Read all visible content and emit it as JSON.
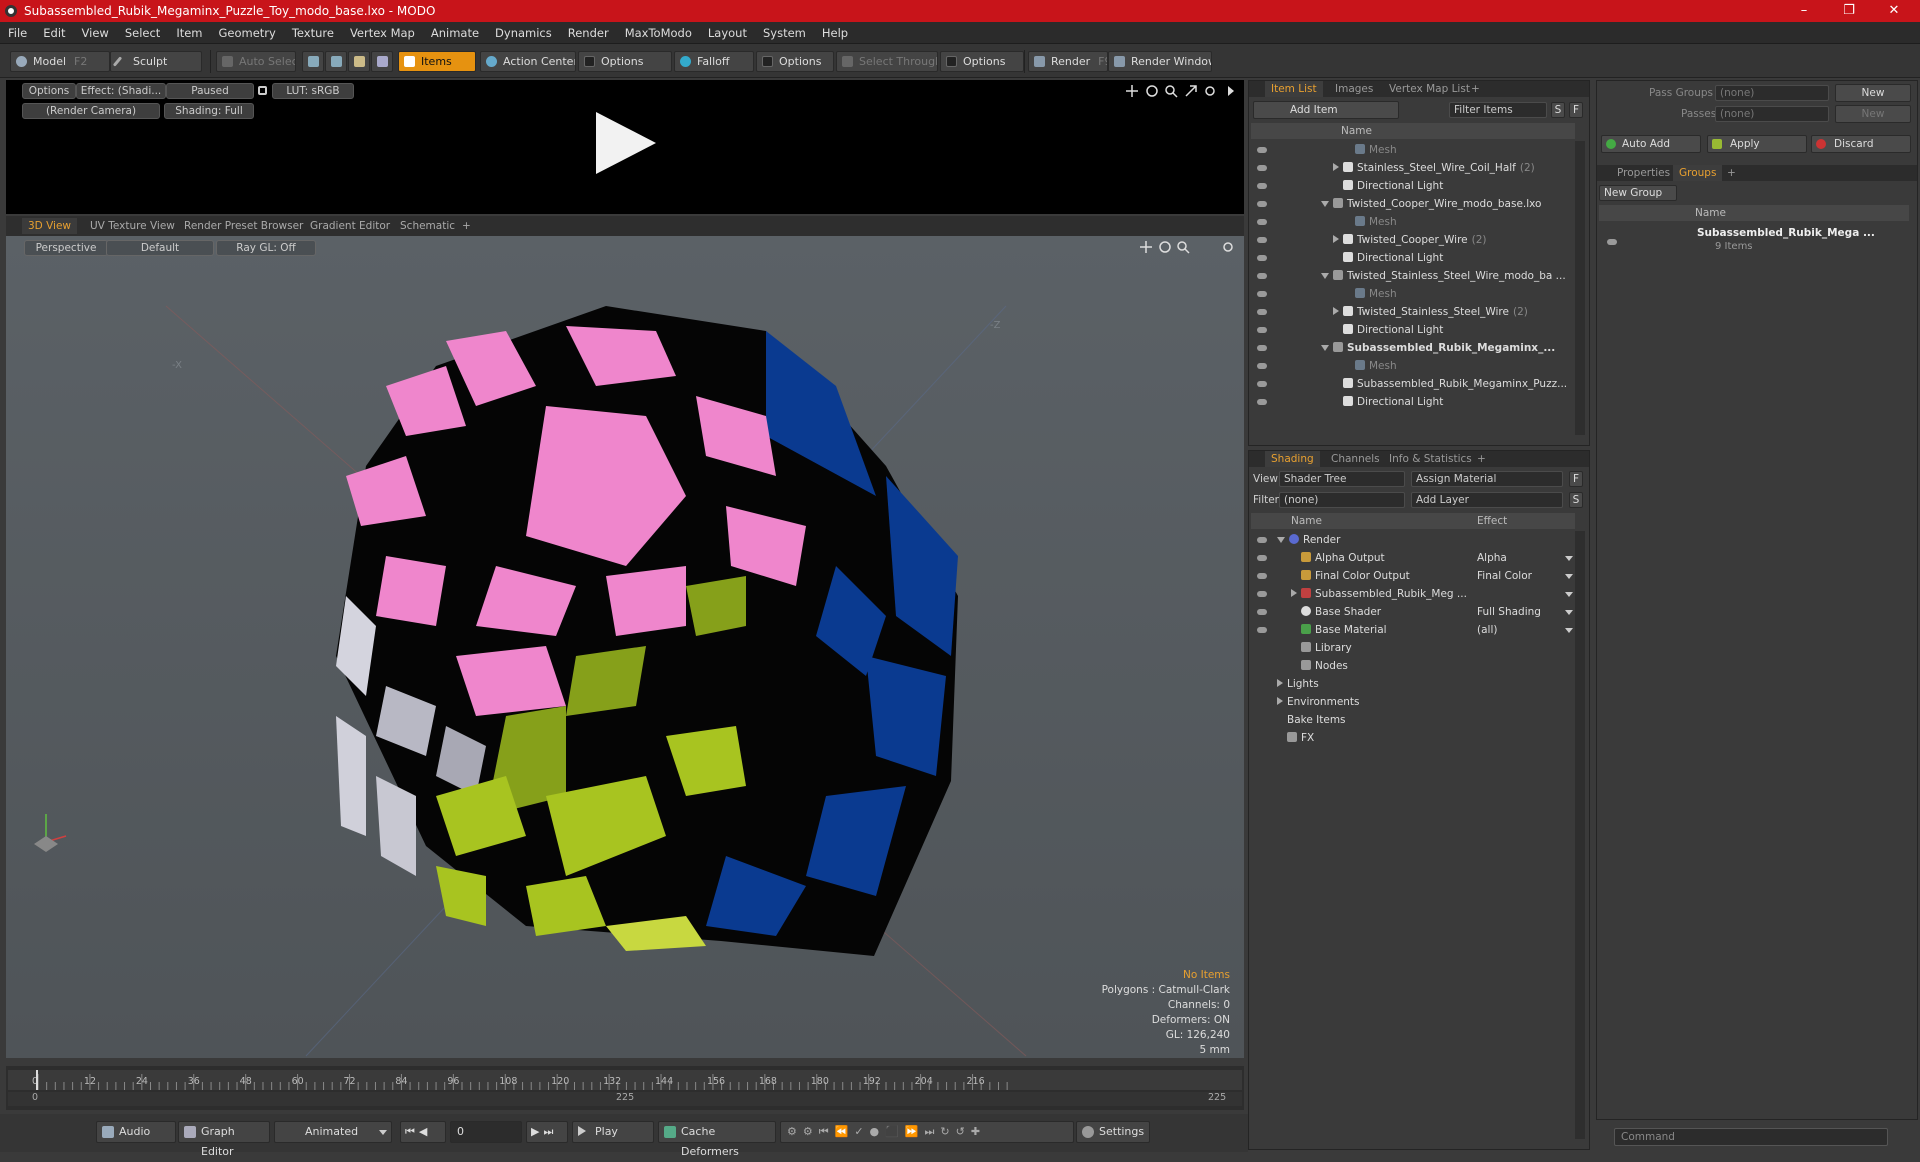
{
  "window": {
    "title": "Subassembled_Rubik_Megaminx_Puzzle_Toy_modo_base.lxo - MODO",
    "controls": [
      "–",
      "❐",
      "✕"
    ]
  },
  "menu": [
    "File",
    "Edit",
    "View",
    "Select",
    "Item",
    "Geometry",
    "Texture",
    "Vertex Map",
    "Animate",
    "Dynamics",
    "Render",
    "MaxToModo",
    "Layout",
    "System",
    "Help"
  ],
  "toolbar": {
    "model": "Model",
    "model_key": "F2",
    "sculpt": "Sculpt",
    "auto_select": "Auto Select",
    "items": "Items",
    "action_center": "Action Center",
    "options1": "Options",
    "falloff": "Falloff",
    "options2": "Options",
    "select_through": "Select Through",
    "options3": "Options",
    "render": "Render",
    "render_key": "F9",
    "render_window": "Render Window"
  },
  "preview": {
    "options": "Options",
    "effect": "Effect: (Shadi...",
    "paused": "Paused",
    "lut": "LUT: sRGB",
    "camera": "(Render Camera)",
    "shading": "Shading: Full"
  },
  "viewtabs": [
    "3D View",
    "UV Texture View",
    "Render Preset Browser",
    "Gradient Editor",
    "Schematic",
    "+"
  ],
  "viewport": {
    "perspective": "Perspective",
    "default": "Default",
    "raygl": "Ray GL: Off",
    "axis_x": "-X",
    "axis_z": "-Z",
    "info": {
      "no_items": "No Items",
      "polygons": "Polygons : Catmull-Clark",
      "channels": "Channels: 0",
      "deformers": "Deformers: ON",
      "gl": "GL: 126,240",
      "scale": "5 mm"
    }
  },
  "timeline": {
    "ticks": [
      "0",
      "12",
      "24",
      "36",
      "48",
      "60",
      "72",
      "84",
      "96",
      "108",
      "120",
      "132",
      "144",
      "156",
      "168",
      "180",
      "192",
      "204",
      "216"
    ],
    "start": "0",
    "mid": "225",
    "end": "225"
  },
  "bottombar": {
    "audio": "Audio",
    "graph_editor": "Graph Editor",
    "animated": "Animated",
    "frame": "0",
    "play": "Play",
    "cache": "Cache Deformers",
    "settings": "Settings"
  },
  "itemlist": {
    "tabs": [
      "Item List",
      "Images",
      "Vertex Map List",
      "+"
    ],
    "add_item": "Add Item",
    "filter_items": "Filter Items",
    "s": "S",
    "f": "F",
    "col_name": "Name",
    "rows": [
      {
        "label": "Mesh",
        "indent": 3,
        "dim": true
      },
      {
        "label": "Stainless_Steel_Wire_Coil_Half",
        "count": "(2)",
        "indent": 2
      },
      {
        "label": "Directional Light",
        "indent": 2
      },
      {
        "label": "Twisted_Cooper_Wire_modo_base.lxo",
        "indent": 1
      },
      {
        "label": "Mesh",
        "indent": 3,
        "dim": true
      },
      {
        "label": "Twisted_Cooper_Wire",
        "count": "(2)",
        "indent": 2
      },
      {
        "label": "Directional Light",
        "indent": 2
      },
      {
        "label": "Twisted_Stainless_Steel_Wire_modo_ba ...",
        "indent": 1
      },
      {
        "label": "Mesh",
        "indent": 3,
        "dim": true
      },
      {
        "label": "Twisted_Stainless_Steel_Wire",
        "count": "(2)",
        "indent": 2
      },
      {
        "label": "Directional Light",
        "indent": 2
      },
      {
        "label": "Subassembled_Rubik_Megaminx_...",
        "indent": 1,
        "bold": true
      },
      {
        "label": "Mesh",
        "indent": 3,
        "dim": true
      },
      {
        "label": "Subassembled_Rubik_Megaminx_Puzz...",
        "indent": 2
      },
      {
        "label": "Directional Light",
        "indent": 2
      }
    ]
  },
  "shading": {
    "tabs": [
      "Shading",
      "Channels",
      "Info & Statistics",
      "+"
    ],
    "view_label": "View",
    "view_value": "Shader Tree",
    "assign": "Assign Material",
    "filter_label": "Filter",
    "filter_value": "(none)",
    "add_layer": "Add Layer",
    "f": "F",
    "s": "S",
    "col_name": "Name",
    "col_effect": "Effect",
    "rows": [
      {
        "label": "Render",
        "effect": "",
        "indent": 0,
        "color": "#5a6ad0"
      },
      {
        "label": "Alpha Output",
        "effect": "Alpha",
        "indent": 1,
        "color": "#c89a3a"
      },
      {
        "label": "Final Color Output",
        "effect": "Final Color",
        "indent": 1,
        "color": "#c89a3a"
      },
      {
        "label": "Subassembled_Rubik_Meg ...",
        "effect": "",
        "indent": 1,
        "color": "#c04040"
      },
      {
        "label": "Base Shader",
        "effect": "Full Shading",
        "indent": 1,
        "color": "#dddddd"
      },
      {
        "label": "Base Material",
        "effect": "(all)",
        "indent": 1,
        "color": "#4aa04a"
      },
      {
        "label": "Library",
        "effect": "",
        "indent": 1,
        "color": "#999"
      },
      {
        "label": "Nodes",
        "effect": "",
        "indent": 1,
        "color": "#999"
      },
      {
        "label": "Lights",
        "effect": "",
        "indent": 0,
        "color": ""
      },
      {
        "label": "Environments",
        "effect": "",
        "indent": 0,
        "color": ""
      },
      {
        "label": "Bake Items",
        "effect": "",
        "indent": 0,
        "color": ""
      },
      {
        "label": "FX",
        "effect": "",
        "indent": 0,
        "color": "#999"
      }
    ]
  },
  "groups": {
    "pass_groups": "Pass Groups",
    "passes": "Passes",
    "none1": "(none)",
    "none2": "(none)",
    "new1": "New",
    "new2": "New",
    "auto_add": "Auto Add",
    "apply": "Apply",
    "discard": "Discard",
    "tabs": [
      "Properties",
      "Groups",
      "+"
    ],
    "new_group": "New Group",
    "col_name": "Name",
    "item": "Subassembled_Rubik_Mega ...",
    "item_count": "9 Items"
  },
  "command": {
    "placeholder": "Command"
  },
  "colors": {
    "accent": "#e69210",
    "titlebar": "#c8141a",
    "pink": "#ee88cc",
    "green": "#9ab81c",
    "blue": "#0a3a90",
    "gray": "#c8c8d4"
  }
}
